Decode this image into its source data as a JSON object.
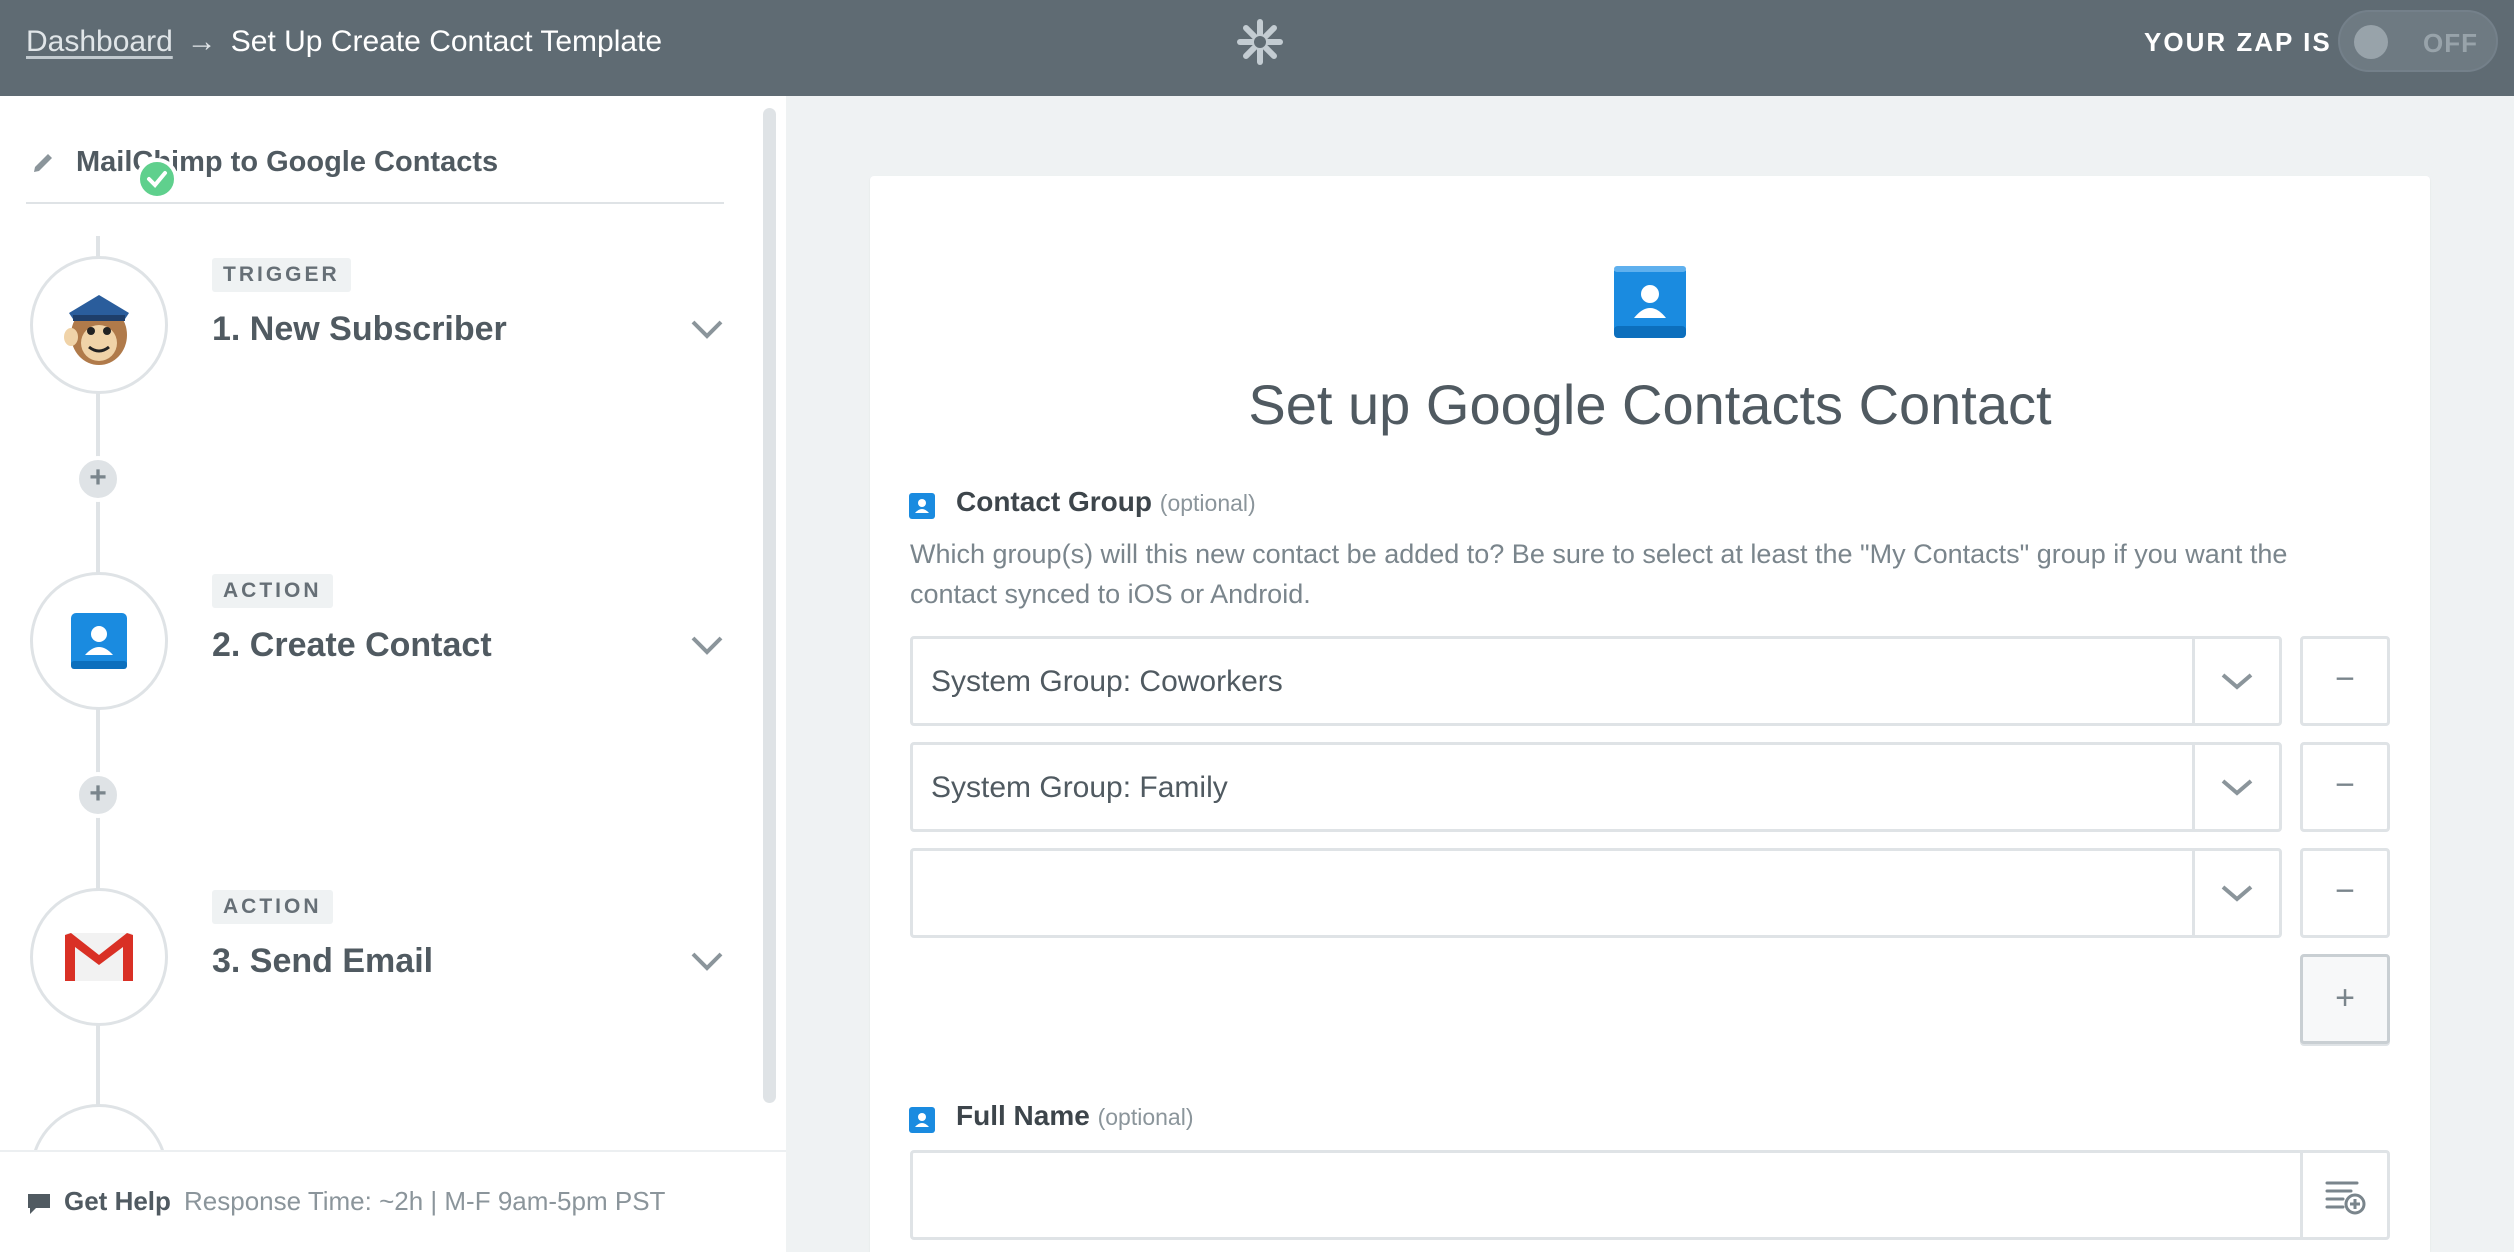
{
  "topbar": {
    "breadcrumb_root": "Dashboard",
    "breadcrumb_sep": "→",
    "breadcrumb_current": "Set Up Create Contact Template",
    "zap_status_label": "YOUR ZAP IS",
    "toggle_state": "OFF"
  },
  "sidebar": {
    "zap_name": "MailChimp to Google Contacts",
    "steps": [
      {
        "badge": "TRIGGER",
        "title": "1. New Subscriber",
        "icon": "mailchimp-icon",
        "complete": true
      },
      {
        "badge": "ACTION",
        "title": "2. Create Contact",
        "icon": "google-contacts-icon",
        "complete": false
      },
      {
        "badge": "ACTION",
        "title": "3. Send Email",
        "icon": "gmail-icon",
        "complete": false
      }
    ],
    "add_step": "+",
    "help": {
      "label": "Get Help",
      "response": "Response Time: ~2h | M-F 9am-5pm PST"
    }
  },
  "main": {
    "title": "Set up Google Contacts Contact",
    "contact_group": {
      "label": "Contact Group",
      "optional": "(optional)",
      "help": "Which group(s) will this new contact be added to? Be sure to select at least the \"My Contacts\" group if you want the contact synced to iOS or Android.",
      "selections": [
        "System Group: Coworkers",
        "System Group: Family",
        ""
      ],
      "remove_symbol": "−",
      "add_symbol": "+"
    },
    "full_name": {
      "label": "Full Name",
      "optional": "(optional)",
      "value": ""
    }
  },
  "colors": {
    "topbar": "#5f6b73",
    "success": "#5fd08d",
    "contacts_blue": "#1a8be0",
    "gmail_red": "#d93025"
  }
}
